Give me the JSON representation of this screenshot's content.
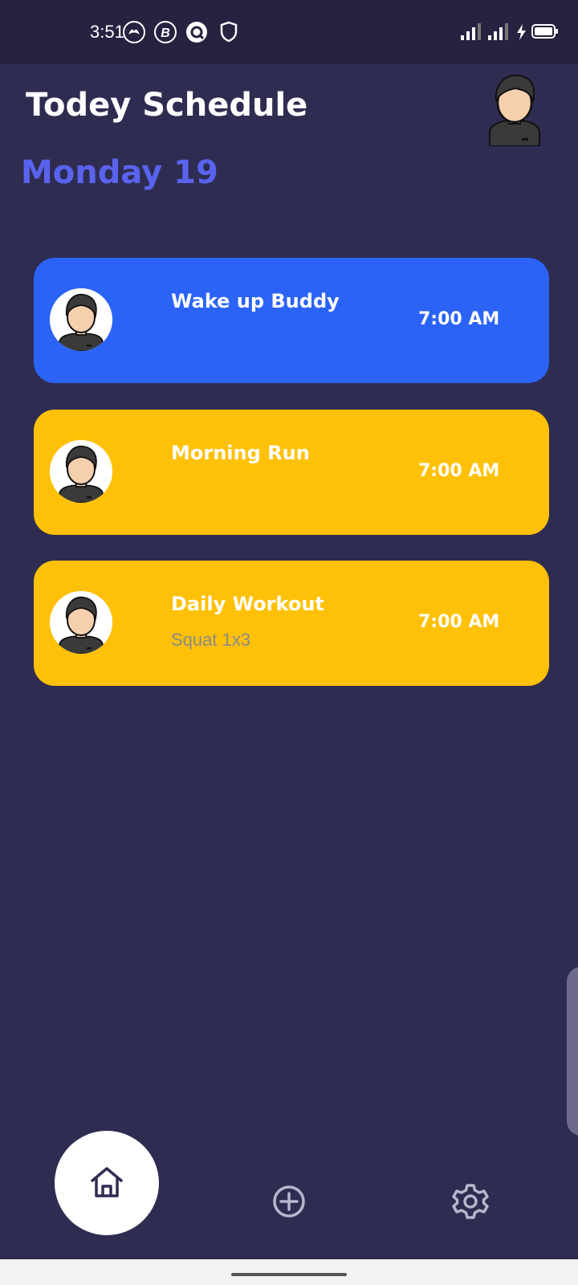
{
  "status_bar": {
    "time": "3:51",
    "icons": [
      "phoenix-app-icon",
      "b-app-icon",
      "q-app-icon",
      "shield-icon",
      "signal-icon",
      "signal-icon",
      "charging-icon",
      "battery-icon"
    ]
  },
  "header": {
    "title": "Todey Schedule",
    "date": "Monday 19",
    "avatar_icon": "avatar-icon"
  },
  "schedule": [
    {
      "title": "Wake up Buddy",
      "subtitle": "",
      "time": "7:00 AM",
      "color": "#2a63f6"
    },
    {
      "title": "Morning Run",
      "subtitle": "",
      "time": "7:00 AM",
      "color": "#ffc107"
    },
    {
      "title": "Daily Workout",
      "subtitle": "Squat 1x3",
      "time": "7:00 AM",
      "color": "#ffc107"
    }
  ],
  "bottom_nav": {
    "items": [
      {
        "icon": "home-icon",
        "active": true
      },
      {
        "icon": "add-circle-icon",
        "active": false
      },
      {
        "icon": "settings-icon",
        "active": false
      }
    ]
  },
  "colors": {
    "background": "#2f2c52",
    "status_bar": "#252340",
    "accent": "#5a63ee",
    "card_blue": "#2a63f6",
    "card_yellow": "#ffc107"
  }
}
